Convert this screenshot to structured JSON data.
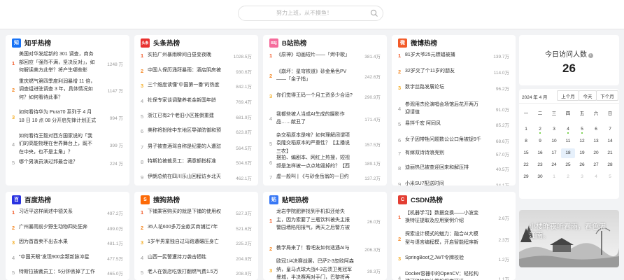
{
  "search": {
    "placeholder": "努力上班，从不摸鱼！"
  },
  "cards": [
    {
      "title": "知乎热榜",
      "logo_text": "知",
      "logo_color": "#1772f6",
      "items": [
        {
          "rank": "1",
          "text": "美国对华发起新的 301 调查，商务部回应「强烈不满，坚决反对」，如何解读美方此举？将产生哪些影响？",
          "heat": "1248 万"
        },
        {
          "rank": "2",
          "text": "重庆燃气第四季度利润暴增 11 倍，调查组进驻调查 3 年，具体情况如何？如何看待此事？",
          "heat": "1147 万"
        },
        {
          "rank": "3",
          "text": "如何看待华为 Pura70 系列于 4 月 18 日 10 点 08 分开启先锋计划正式开售？",
          "heat": "994 万"
        },
        {
          "rank": "4",
          "text": "如何看待王毅对西方国家说的「我们的高能物理在世界舞台上，既不在中央，也不是主角」？",
          "heat": "399 万"
        },
        {
          "rank": "5",
          "text": "哪个男演员演过邦最合适？",
          "heat": "224 万"
        }
      ]
    },
    {
      "title": "头条热榜",
      "logo_text": "头条",
      "logo_color": "#e8312f",
      "items": [
        {
          "rank": "1",
          "text": "实拍广州暴雨瞬间白昼变夜晚",
          "heat": "1028.5万"
        },
        {
          "rank": "2",
          "text": "中国人保历涌拜暴雨：酒店阴房被淹",
          "heat": "930.6万"
        },
        {
          "rank": "3",
          "text": "三个维度读懂“中国第一番”的热度",
          "heat": "842.1万"
        },
        {
          "rank": "4",
          "text": "社保专家谈调整养老金新国年龄",
          "heat": "769.4万"
        },
        {
          "rank": "5",
          "text": "浙江已有2个老旧小区推倒重建",
          "heat": "681.9万"
        },
        {
          "rank": "6",
          "text": "美称将扮除中东地区导弹防御和预警",
          "heat": "623.8万"
        },
        {
          "rank": "7",
          "text": "男子被查酒驾自称是纪委的人遭怼",
          "heat": "564.5万"
        },
        {
          "rank": "8",
          "text": "特斯拉被裁员工：满意额指标准",
          "heat": "504.6万"
        },
        {
          "rank": "9",
          "text": "伊朗总统在四川乐山回程访乡北天",
          "heat": "462.1万"
        }
      ]
    },
    {
      "title": "B站热榜",
      "logo_text": "B站",
      "logo_color": "#f56c9c",
      "items": [
        {
          "rank": "1",
          "text": "《原神》动画短片——「烬中歌」",
          "heat": "381.4万"
        },
        {
          "rank": "2",
          "text": "《崩坏：星穹铁道》砂金角色PV——「金子指」",
          "heat": "242.6万"
        },
        {
          "rank": "3",
          "text": "你们觉得王码一个月工资多少合适?",
          "heat": "290.9万"
        },
        {
          "rank": "4",
          "text": "我都些被人当成AI生成的摄影作品……献丑了",
          "heat": "171.4万"
        },
        {
          "rank": "5",
          "text": "杂交稻原本是啥？如何理解闭谓项袁隆交稻原本的严重性？【主播说三农】",
          "heat": "157.5万"
        },
        {
          "rank": "6",
          "text": "摆拍、编剧本、网红上热搜，短视频是怎样被一点点地毁掉的？【西罗夜谈】",
          "heat": "189.1万"
        },
        {
          "rank": "7",
          "text": "虚一般叫 | 《与砂金岳翁的一日约会》",
          "heat": "137.2万"
        }
      ]
    },
    {
      "title": "微博热榜",
      "logo_text": "微",
      "logo_color": "#f25b29",
      "items": [
        {
          "rank": "1",
          "text": "81岁大爷25元嫖娼被捕",
          "heat": "139.7万"
        },
        {
          "rank": "2",
          "text": "32岁交了个11岁的朋友",
          "heat": "114.0万"
        },
        {
          "rank": "3",
          "text": "数字丝路发展论坛",
          "heat": "96.2万"
        },
        {
          "rank": "4",
          "text": "参观用杰伦演唱会场馆后花开两万迎请值",
          "heat": "91.0万"
        },
        {
          "rank": "5",
          "text": "易拌千宏 阿同风",
          "heat": "85.2万"
        },
        {
          "rank": "6",
          "text": "女子因带牲问题数公公口角被捉9千皆",
          "heat": "68.6万"
        },
        {
          "rank": "7",
          "text": "有嫁双诗诗浪壳别",
          "heat": "57.0万"
        },
        {
          "rank": "8",
          "text": "迪丽热巴被查迎回来和解压排",
          "heat": "40.5万"
        },
        {
          "rank": "9",
          "text": "小米SU7配送时间",
          "heat": "34.1万"
        }
      ]
    },
    {
      "title": "百度热榜",
      "logo_text": "百",
      "logo_color": "#2932e1",
      "items": [
        {
          "rank": "1",
          "text": "习近平这样阐述中德关系",
          "heat": "497.2万"
        },
        {
          "rank": "2",
          "text": "广州暴雨前夕野生动物四处狂奔",
          "heat": "499.0万"
        },
        {
          "rank": "3",
          "text": "因为首首卖不出去水果",
          "heat": "481.1万"
        },
        {
          "rank": "4",
          "text": "\"中国天眼\"发现900余颗新脉冲星",
          "heat": "477.5万"
        },
        {
          "rank": "5",
          "text": "特斯拉被裁员工：5分钟丢掉了工作",
          "heat": "465.0万"
        }
      ]
    },
    {
      "title": "搜狗热榜",
      "logo_text": "S",
      "logo_color": "#fd6a07",
      "items": [
        {
          "rank": "1",
          "text": "下铺乘客购买的就是下铺的使用权",
          "heat": "527.3万"
        },
        {
          "rank": "2",
          "text": "35人花600多万全款买商铺拦7年",
          "heat": "521.6万"
        },
        {
          "rank": "3",
          "text": "1岁半男童独自过马路遭碾压身亡",
          "heat": "225.2万"
        },
        {
          "rank": "4",
          "text": "山西一民警遭持刀袭击牺牲",
          "heat": "204.9万"
        },
        {
          "rank": "5",
          "text": "老人在饭店吃饭打翻燃气费1.5万",
          "heat": "208.9万"
        }
      ]
    },
    {
      "title": "贴吧热榜",
      "logo_text": "贴",
      "logo_color": "#3878f5",
      "items": [
        {
          "rank": "1",
          "text": "龙岩学院肥胖找到手机扣还给失主，因为索要了三瓶饮料被失主报警园墙陷阳报气，两天之后警方被迫到通报的事会怎么看？",
          "heat": "26.0万"
        },
        {
          "rank": "2",
          "text": "教学局来了！看吧友如何适遇AI与教育。",
          "heat": "206.3万"
        },
        {
          "rank": "3",
          "text": "欧冠1/4决赛战罢，巴萨2-3忽败阿森纳，皇马点球大战4-3击溃卫冕冠军曼城，半决赛两对手门，巴黎将再次主场晋级",
          "heat": "39.3万"
        }
      ]
    },
    {
      "title": "CSDN热榜",
      "logo_text": "C",
      "logo_color": "#e33e33",
      "items": [
        {
          "rank": "1",
          "text": "【机器学习】数据变换——小波变换特征提取及应用案例介绍",
          "heat": "2.6万"
        },
        {
          "rank": "2",
          "text": "探索设计模式的魅力：融合AI大模型与语言编程模，开启智能程序新纪元",
          "heat": "2.3万"
        },
        {
          "rank": "3",
          "text": "SpringBoot之JWT令牌校验",
          "heat": "1.2万"
        },
        {
          "rank": "4",
          "text": "Docker容器中的OpenCV：轻松构建可移植的计算机视觉环境",
          "heat": "1.1万"
        }
      ]
    }
  ],
  "visits": {
    "label": "今日访问人数",
    "info_icon": "info-icon",
    "count": "26"
  },
  "calendar": {
    "month_label": "2024 年 4 月",
    "buttons": [
      "上个月",
      "今天",
      "下个月"
    ],
    "weekdays": [
      "一",
      "二",
      "三",
      "四",
      "五",
      "六",
      "日"
    ],
    "today": "18",
    "weeks": [
      [
        "",
        "1",
        "2",
        "3",
        "4",
        "5",
        "6",
        "7"
      ],
      [
        "8",
        "9",
        "10",
        "11",
        "12",
        "13",
        "14"
      ],
      [
        "15",
        "16",
        "17",
        "18",
        "19",
        "20",
        "21"
      ],
      [
        "22",
        "23",
        "24",
        "25",
        "26",
        "27",
        "28"
      ],
      [
        "29",
        "30",
        "1",
        "2",
        "3",
        "4",
        "5"
      ]
    ]
  },
  "banner": {
    "text": "小楼昨夜听春雨，春色满江南。"
  }
}
